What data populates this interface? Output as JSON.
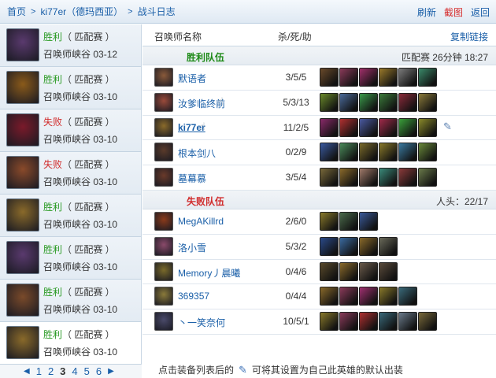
{
  "breadcrumb": {
    "home": "首页",
    "player": "ki77er（德玛西亚）",
    "page": "战斗日志"
  },
  "top_actions": {
    "refresh": "刷新",
    "screenshot": "截图",
    "back": "返回"
  },
  "matches": [
    {
      "result": "胜利",
      "kind": "win",
      "mode": "（ 匹配赛 ）",
      "map": "召唤师峡谷",
      "date": "03-12",
      "color": "#5a3a6e"
    },
    {
      "result": "胜利",
      "kind": "win",
      "mode": "（ 匹配赛 ）",
      "map": "召唤师峡谷",
      "date": "03-10",
      "color": "#8a5a1a"
    },
    {
      "result": "失败",
      "kind": "lose",
      "mode": "（ 匹配赛 ）",
      "map": "召唤师峡谷",
      "date": "03-10",
      "color": "#7a1a2a"
    },
    {
      "result": "失败",
      "kind": "lose",
      "mode": "（ 匹配赛 ）",
      "map": "召唤师峡谷",
      "date": "03-10",
      "color": "#8a4a2a"
    },
    {
      "result": "胜利",
      "kind": "win",
      "mode": "（ 匹配赛 ）",
      "map": "召唤师峡谷",
      "date": "03-10",
      "color": "#8a6a2a"
    },
    {
      "result": "胜利",
      "kind": "win",
      "mode": "（ 匹配赛 ）",
      "map": "召唤师峡谷",
      "date": "03-10",
      "color": "#5a3a6e"
    },
    {
      "result": "胜利",
      "kind": "win",
      "mode": "（ 匹配赛 ）",
      "map": "召唤师峡谷",
      "date": "03-10",
      "color": "#7a4a2a"
    },
    {
      "result": "胜利",
      "kind": "win",
      "mode": "（ 匹配赛 ）",
      "map": "召唤师峡谷",
      "date": "03-10",
      "color": "#8a6a2a"
    }
  ],
  "pager": {
    "pages": [
      "1",
      "2",
      "3",
      "4",
      "5",
      "6"
    ],
    "current": "3"
  },
  "table": {
    "col_name": "召唤师名称",
    "col_kda": "杀/死/助",
    "copy_link": "复制链接"
  },
  "win_team": {
    "label": "胜利队伍",
    "info": "匹配赛 26分钟 18:27",
    "players": [
      {
        "name": "默语者",
        "kda": "3/5/5",
        "color": "#8a5a3a",
        "items": [
          "#6a4a2a",
          "#8a3a5a",
          "#a0306a",
          "#9a7a2a",
          "#7a7a7a",
          "#3a8a6a"
        ]
      },
      {
        "name": "汝爹临终前",
        "kda": "5/3/13",
        "color": "#9a4a3a",
        "items": [
          "#6a8a2a",
          "#4a6a9a",
          "#3a9a4a",
          "#3a7a3a",
          "#8a2a3a",
          "#8a7a3a"
        ]
      },
      {
        "name": "ki77er",
        "kda": "11/2/5",
        "color": "#8a6a2a",
        "me": true,
        "items": [
          "#8a2a6a",
          "#b03030",
          "#4a5aa0",
          "#a02a4a",
          "#3aa03a",
          "#8a8a2a"
        ]
      },
      {
        "name": "根本剑八",
        "kda": "0/2/9",
        "color": "#5a3a2a",
        "items": [
          "#3a5aa0",
          "#4a8a5a",
          "#7a6a2a",
          "#8a7a2a",
          "#3a7aa0",
          "#6a8a3a"
        ]
      },
      {
        "name": "墓幕慕",
        "kda": "3/5/4",
        "color": "#6a3a2a",
        "items": [
          "#7a6a3a",
          "#8a6a2a",
          "#a07a6a",
          "#3a8a7a",
          "#8a3a3a",
          "#6a7a4a"
        ]
      }
    ]
  },
  "lose_team": {
    "label": "失败队伍",
    "info": "人头：22/17",
    "players": [
      {
        "name": "MegAKillrd",
        "kda": "2/6/0",
        "color": "#8a3a1a",
        "items": [
          "#8a7a2a",
          "#4a6a4a",
          "#3a5a9a"
        ]
      },
      {
        "name": "洛小雪",
        "kda": "5/3/2",
        "color": "#8a4a6a",
        "items": [
          "#2a4a8a",
          "#3a6aa0",
          "#8a6a2a",
          "#6a6a5a"
        ]
      },
      {
        "name": "Memory丿晨曦",
        "kda": "0/4/6",
        "color": "#7a6a2a",
        "items": [
          "#5a4a2a",
          "#8a6a2a",
          "#6a5a4a",
          "#5a4a3a"
        ]
      },
      {
        "name": "369357",
        "kda": "0/4/4",
        "color": "#8a7a3a",
        "items": [
          "#8a6a2a",
          "#8a3a5a",
          "#a03070",
          "#8a7a2a",
          "#3a6a7a"
        ]
      },
      {
        "name": "丶一笑奈何",
        "kda": "10/5/1",
        "color": "#4a4a6a",
        "items": [
          "#8a7a2a",
          "#8a3a5a",
          "#b03030",
          "#3a6a7a",
          "#6a7a8a",
          "#7a6a3a"
        ]
      }
    ]
  },
  "footer": {
    "before": "点击装备列表后的",
    "after": "可将其设置为自己此英雄的默认出装"
  },
  "colors": {
    "link": "#1a5fa8",
    "win": "#2a9a24",
    "lose": "#d12d2d"
  },
  "icons": {
    "hand": "hand-pointer-icon",
    "pin": "pin-icon"
  }
}
